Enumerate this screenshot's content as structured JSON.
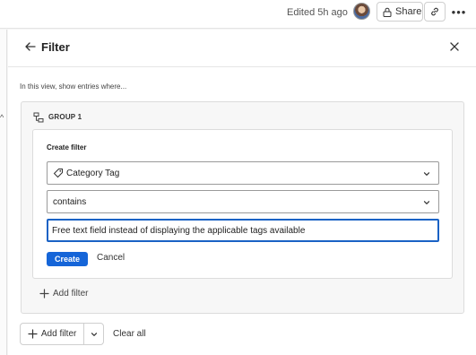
{
  "topbar": {
    "edited_text": "Edited 5h ago",
    "share_label": "Share",
    "more_label": "•••"
  },
  "panel": {
    "title": "Filter",
    "intro": "In this view, show entries where...",
    "group": {
      "title": "GROUP 1",
      "card": {
        "title": "Create filter",
        "field_select": "Category Tag",
        "operator_select": "contains",
        "value_input": "Free text field instead of displaying the applicable tags available",
        "create_label": "Create",
        "cancel_label": "Cancel"
      },
      "add_filter_label": "Add filter"
    },
    "footer": {
      "add_filter_label": "Add filter",
      "clear_all_label": "Clear all"
    }
  },
  "colors": {
    "accent": "#1565d8",
    "focus_border": "#1a62c5"
  },
  "icons": [
    "lock-icon",
    "link-icon",
    "more-icon",
    "back-arrow-icon",
    "close-icon",
    "group-icon",
    "tag-icon",
    "chevron-down-icon",
    "plus-icon"
  ]
}
